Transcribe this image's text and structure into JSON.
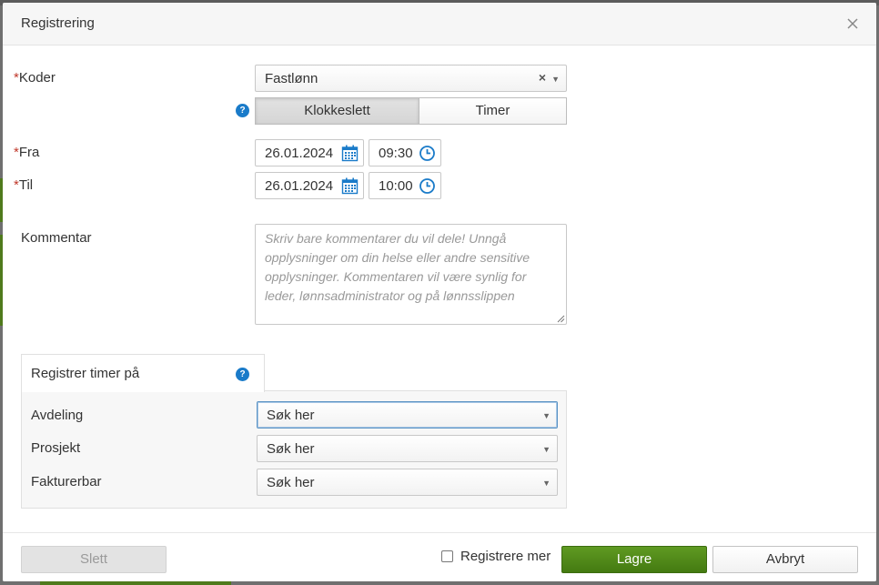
{
  "dialog": {
    "title": "Registrering",
    "close_icon": "close-icon"
  },
  "form": {
    "code": {
      "label": "Koder",
      "required_marker": "*",
      "value": "Fastlønn",
      "clear_glyph": "×",
      "caret_glyph": "▼"
    },
    "mode_toggle": {
      "help_glyph": "?",
      "options": [
        "Klokkeslett",
        "Timer"
      ],
      "active": "Klokkeslett"
    },
    "from": {
      "label": "Fra",
      "required_marker": "*",
      "date": "26.01.2024",
      "time": "09:30"
    },
    "to": {
      "label": "Til",
      "required_marker": "*",
      "date": "26.01.2024",
      "time": "10:00"
    },
    "comment": {
      "label": "Kommentar",
      "placeholder": "Skriv bare kommentarer du vil dele! Unngå opplysninger om din helse eller andre sensitive opplysninger. Kommentaren vil være synlig for leder, lønnsadministrator og på lønnsslippen",
      "value": ""
    }
  },
  "register_hours": {
    "tab_label": "Registrer timer på",
    "help_glyph": "?",
    "fields": [
      {
        "label": "Avdeling",
        "placeholder": "Søk her"
      },
      {
        "label": "Prosjekt",
        "placeholder": "Søk her"
      },
      {
        "label": "Fakturerbar",
        "placeholder": "Søk her"
      }
    ],
    "caret_glyph": "▼"
  },
  "footer": {
    "delete_label": "Slett",
    "register_more_label": "Registrere mer",
    "register_more_checked": false,
    "save_label": "Lagre",
    "cancel_label": "Avbryt"
  },
  "colors": {
    "accent_green": "#4f8a17",
    "required_red": "#c0392b",
    "icon_blue": "#1a7bc9"
  }
}
